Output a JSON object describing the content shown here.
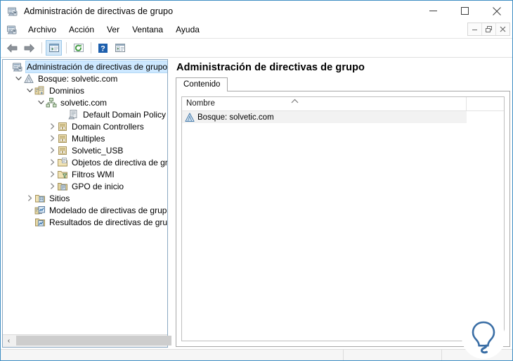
{
  "window": {
    "title": "Administración de directivas de grupo",
    "icon": "mmc-console-icon",
    "controls": [
      {
        "name": "minimize-button",
        "glyph": "minimize"
      },
      {
        "name": "maximize-button",
        "glyph": "maximize"
      },
      {
        "name": "close-button",
        "glyph": "close"
      }
    ]
  },
  "menubar": {
    "icon": "mmc-console-icon",
    "items": [
      {
        "label": "Archivo"
      },
      {
        "label": "Acción"
      },
      {
        "label": "Ver"
      },
      {
        "label": "Ventana"
      },
      {
        "label": "Ayuda"
      }
    ],
    "mdi_controls": [
      {
        "name": "mdi-minimize-button",
        "glyph": "minimize"
      },
      {
        "name": "mdi-restore-button",
        "glyph": "restore"
      },
      {
        "name": "mdi-close-button",
        "glyph": "close"
      }
    ]
  },
  "toolbar": {
    "buttons": [
      {
        "name": "back-button",
        "icon": "back-arrow-icon",
        "active": false
      },
      {
        "name": "forward-button",
        "icon": "forward-arrow-icon",
        "active": false
      },
      {
        "name": "show-tree-button",
        "icon": "show-console-tree-icon",
        "active": true
      },
      {
        "name": "refresh-button",
        "icon": "refresh-icon",
        "active": false
      },
      {
        "name": "help-button",
        "icon": "help-question-icon",
        "active": false
      },
      {
        "name": "properties-button",
        "icon": "properties-window-icon",
        "active": false
      }
    ]
  },
  "tree": {
    "nodes": [
      {
        "label": "Administración de directivas de grupo",
        "indent": 0,
        "twist": "none",
        "icon": "mmc-console-icon",
        "selected": true
      },
      {
        "label": "Bosque: solvetic.com",
        "indent": 1,
        "twist": "expanded",
        "icon": "forest-icon",
        "selected": false
      },
      {
        "label": "Dominios",
        "indent": 2,
        "twist": "expanded",
        "icon": "domains-icon",
        "selected": false
      },
      {
        "label": "solvetic.com",
        "indent": 3,
        "twist": "expanded",
        "icon": "domain-icon",
        "selected": false
      },
      {
        "label": "Default Domain Policy",
        "indent": 5,
        "twist": "none",
        "icon": "gpo-link-icon",
        "selected": false
      },
      {
        "label": "Domain Controllers",
        "indent": 4,
        "twist": "collapsed",
        "icon": "ou-icon",
        "selected": false
      },
      {
        "label": "Multiples",
        "indent": 4,
        "twist": "collapsed",
        "icon": "ou-icon",
        "selected": false
      },
      {
        "label": "Solvetic_USB",
        "indent": 4,
        "twist": "collapsed",
        "icon": "ou-icon",
        "selected": false
      },
      {
        "label": "Objetos de directiva de gru",
        "indent": 4,
        "twist": "collapsed",
        "icon": "gpo-folder-icon",
        "selected": false
      },
      {
        "label": "Filtros WMI",
        "indent": 4,
        "twist": "collapsed",
        "icon": "wmi-filter-icon",
        "selected": false
      },
      {
        "label": "GPO de inicio",
        "indent": 4,
        "twist": "collapsed",
        "icon": "starter-gpo-icon",
        "selected": false
      },
      {
        "label": "Sitios",
        "indent": 2,
        "twist": "collapsed",
        "icon": "sites-icon",
        "selected": false
      },
      {
        "label": "Modelado de directivas de grupo",
        "indent": 2,
        "twist": "none",
        "icon": "modeling-icon",
        "selected": false
      },
      {
        "label": "Resultados de directivas de grupo",
        "indent": 2,
        "twist": "none",
        "icon": "results-icon",
        "selected": false
      }
    ],
    "hscroll": {
      "left_arrow": "‹",
      "right_arrow": "›"
    }
  },
  "right_pane": {
    "title": "Administración de directivas de grupo",
    "tabs": [
      {
        "label": "Contenido",
        "active": true
      }
    ],
    "list": {
      "columns": [
        {
          "label": "Nombre",
          "sort": "ascending",
          "sort_glyph": "^"
        }
      ],
      "rows": [
        {
          "icon": "forest-icon",
          "name": "Bosque: solvetic.com"
        }
      ]
    },
    "watermark": "lightbulb-logo"
  },
  "statusbar": {
    "cells": [
      "",
      "",
      ""
    ]
  },
  "colors": {
    "window_border": "#3f8fc4",
    "selection": "#cde8ff",
    "toolbar_active": "#d3e7f7",
    "pane_border": "#8aa8c2",
    "row_alt": "#f2f2f2",
    "brand_blue": "#3a6ea5"
  }
}
